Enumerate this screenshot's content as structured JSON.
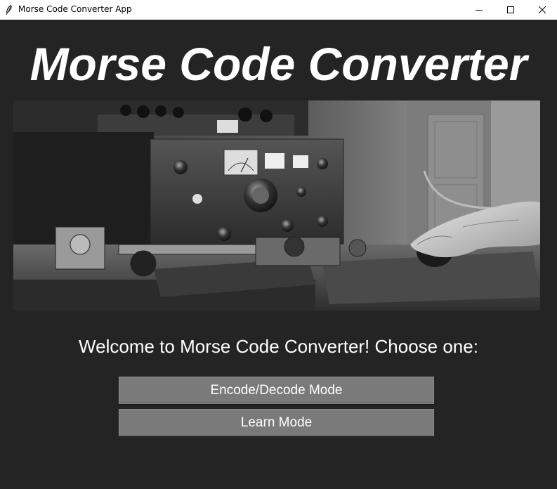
{
  "window": {
    "title": "Morse Code Converter App",
    "icons": [
      "feather-icon",
      "minimize-icon",
      "maximize-icon",
      "close-icon"
    ]
  },
  "main": {
    "heading": "Morse Code Converter",
    "welcome_text": "Welcome to Morse Code Converter! Choose one:",
    "buttons": {
      "encode_decode": "Encode/Decode Mode",
      "learn": "Learn Mode"
    }
  },
  "colors": {
    "background": "#242424",
    "button": "#7a7a7a",
    "text": "#ffffff"
  }
}
